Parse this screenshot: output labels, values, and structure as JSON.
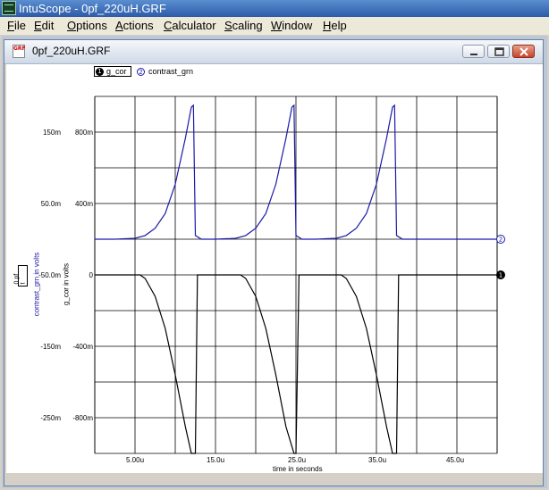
{
  "app": {
    "title": "IntuScope - 0pf_220uH.GRF",
    "icon": "intuscope-app-icon"
  },
  "menu": [
    "File",
    "Edit",
    "Options",
    "Actions",
    "Calculator",
    "Scaling",
    "Window",
    "Help"
  ],
  "child_window": {
    "title": "0pf_220uH.GRF",
    "icon_text": "GRF",
    "buttons": [
      "minimize-icon",
      "maximize-icon",
      "close-icon"
    ]
  },
  "colors": {
    "g_cor": "#000000",
    "contrast_grn": "#1a1aa8",
    "grid": "#000000",
    "background": "#ffffff"
  },
  "chart_data": {
    "type": "line",
    "xlabel": "time in seconds",
    "x_ticks": [
      "5.00u",
      "15.0u",
      "25.0u",
      "35.0u",
      "45.0u"
    ],
    "left_ylabel": "contrast_grn in volts",
    "left_ticks": [
      "150m",
      "50.0m",
      "-50.0m",
      "-150m",
      "-250m"
    ],
    "right_ylabel": "g_cor in volts",
    "right_ticks": [
      "800m",
      "400m",
      "0",
      "-400m",
      "-800m"
    ],
    "grf_badge": "0 pf t",
    "series": [
      {
        "name": "g_cor",
        "marker": "1",
        "color": "#000000",
        "x": [
          0,
          4.5,
          5.0,
          6.0,
          7.0,
          8.0,
          9.0,
          9.6,
          10.0,
          10.2,
          10.8,
          12.0,
          14.5,
          15.0,
          16.0,
          17.0,
          18.0,
          19.0,
          19.8,
          20.0,
          20.3,
          20.8,
          22.0,
          24.5,
          25.0,
          26.0,
          27.0,
          28.0,
          29.0,
          29.6,
          30.0,
          30.2,
          30.8,
          32.0,
          34.5,
          35.0,
          36.0,
          37.0,
          38.0,
          39.0,
          40.0
        ],
        "y": [
          0,
          0,
          -20,
          -120,
          -300,
          -560,
          -850,
          -1000,
          -1000,
          0,
          0,
          0,
          0,
          -20,
          -120,
          -300,
          -560,
          -850,
          -1000,
          -1000,
          0,
          0,
          0,
          0,
          -20,
          -120,
          -300,
          -560,
          -850,
          -1000,
          -1000,
          0,
          0,
          0,
          0,
          0,
          0,
          0,
          0,
          0,
          0
        ]
      },
      {
        "name": "contrast_grn",
        "marker": "2",
        "color": "#1a1aa8",
        "x": [
          0,
          2.0,
          4.0,
          5.0,
          6.0,
          7.0,
          8.0,
          9.0,
          9.6,
          9.8,
          10.0,
          10.6,
          12.0,
          14.0,
          15.0,
          16.0,
          17.0,
          18.0,
          19.0,
          19.6,
          19.8,
          20.0,
          20.6,
          22.0,
          24.0,
          25.0,
          26.0,
          27.0,
          28.0,
          29.0,
          29.6,
          29.8,
          30.0,
          30.6,
          32.0,
          34.0,
          35.0,
          36.0,
          37.0,
          38.0,
          40.0
        ],
        "y": [
          0,
          0,
          0.5,
          2,
          6,
          14,
          30,
          55,
          72,
          73,
          2,
          0,
          0,
          0.5,
          2,
          6,
          14,
          30,
          55,
          72,
          73,
          2,
          0,
          0,
          0.5,
          2,
          6,
          14,
          30,
          55,
          72,
          73,
          2,
          0,
          0,
          0,
          0,
          0,
          0,
          0,
          0
        ]
      }
    ]
  }
}
